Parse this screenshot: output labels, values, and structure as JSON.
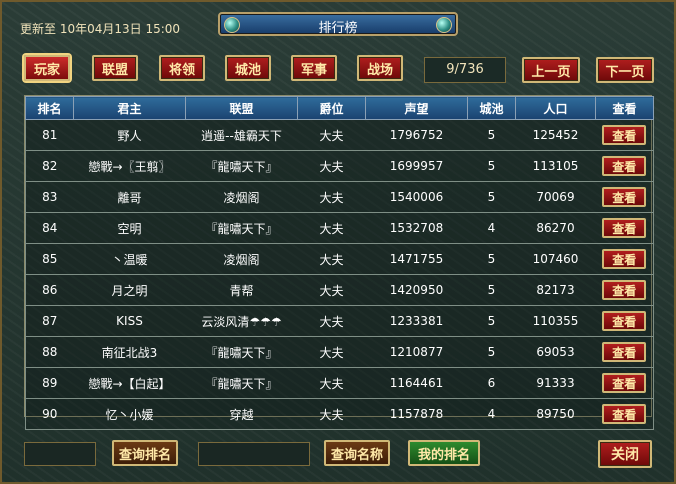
{
  "header": {
    "update_label": "更新至 10年04月13日 15:00",
    "title": "排行榜"
  },
  "tabs": [
    {
      "label": "玩家",
      "active": true
    },
    {
      "label": "联盟",
      "active": false
    },
    {
      "label": "将领",
      "active": false
    },
    {
      "label": "城池",
      "active": false
    },
    {
      "label": "军事",
      "active": false
    },
    {
      "label": "战场",
      "active": false
    }
  ],
  "pagination": {
    "indicator": "9/736",
    "prev_label": "上一页",
    "next_label": "下一页"
  },
  "table": {
    "columns": [
      "排名",
      "君主",
      "联盟",
      "爵位",
      "声望",
      "城池",
      "人口",
      "查看"
    ],
    "rows": [
      {
        "rank": "81",
        "lord": "野人",
        "alliance": "逍遥--雄霸天下",
        "title": "大夫",
        "prestige": "1796752",
        "cities": "5",
        "population": "125452"
      },
      {
        "rank": "82",
        "lord": "戀戰→〖王翦〗",
        "alliance": "『龍嘯天下』",
        "title": "大夫",
        "prestige": "1699957",
        "cities": "5",
        "population": "113105"
      },
      {
        "rank": "83",
        "lord": "離哥",
        "alliance": "凌烟阁",
        "title": "大夫",
        "prestige": "1540006",
        "cities": "5",
        "population": "70069"
      },
      {
        "rank": "84",
        "lord": "空明",
        "alliance": "『龍嘯天下』",
        "title": "大夫",
        "prestige": "1532708",
        "cities": "4",
        "population": "86270"
      },
      {
        "rank": "85",
        "lord": "丶温暖",
        "alliance": "凌烟阁",
        "title": "大夫",
        "prestige": "1471755",
        "cities": "5",
        "population": "107460"
      },
      {
        "rank": "86",
        "lord": "月之明",
        "alliance": "青帮",
        "title": "大夫",
        "prestige": "1420950",
        "cities": "5",
        "population": "82173"
      },
      {
        "rank": "87",
        "lord": "KISS",
        "alliance": "云淡风清☂☂☂",
        "title": "大夫",
        "prestige": "1233381",
        "cities": "5",
        "population": "110355"
      },
      {
        "rank": "88",
        "lord": "南征北战3",
        "alliance": "『龍嘯天下』",
        "title": "大夫",
        "prestige": "1210877",
        "cities": "5",
        "population": "69053"
      },
      {
        "rank": "89",
        "lord": "戀戰→【白起】",
        "alliance": "『龍嘯天下』",
        "title": "大夫",
        "prestige": "1164461",
        "cities": "6",
        "population": "91333"
      },
      {
        "rank": "90",
        "lord": "忆丶小媛",
        "alliance": "穿越",
        "title": "大夫",
        "prestige": "1157878",
        "cities": "4",
        "population": "89750"
      }
    ],
    "view_label": "查看"
  },
  "footer": {
    "query_rank_label": "查询排名",
    "query_name_label": "查询名称",
    "my_rank_label": "我的排名",
    "close_label": "关闭",
    "rank_input_value": "",
    "name_input_value": ""
  }
}
